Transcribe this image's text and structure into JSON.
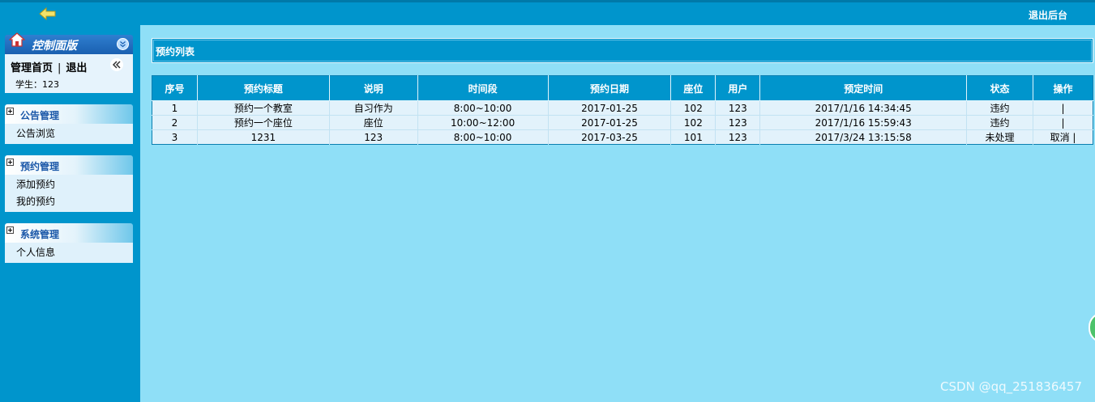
{
  "topbar": {
    "logout_label": "退出后台",
    "back_icon": "back-arrow-icon"
  },
  "sidebar": {
    "panel_title": "控制面版",
    "home_link": "管理首页",
    "separator": "|",
    "exit_link": "退出",
    "student_label": "学生：123",
    "groups": [
      {
        "title": "公告管理",
        "items": [
          "公告浏览"
        ]
      },
      {
        "title": "预约管理",
        "items": [
          "添加预约",
          "我的预约"
        ]
      },
      {
        "title": "系统管理",
        "items": [
          "个人信息"
        ]
      }
    ]
  },
  "main": {
    "list_title": "预约列表",
    "table": {
      "headers": [
        "序号",
        "预约标题",
        "说明",
        "时间段",
        "预约日期",
        "座位",
        "用户",
        "预定时间",
        "状态",
        "操作"
      ],
      "rows": [
        [
          "1",
          "预约一个教室",
          "自习作为",
          "8:00~10:00",
          "2017-01-25",
          "102",
          "123",
          "2017/1/16 14:34:45",
          "违约",
          "|"
        ],
        [
          "2",
          "预约一个座位",
          "座位",
          "10:00~12:00",
          "2017-01-25",
          "102",
          "123",
          "2017/1/16 15:59:43",
          "违约",
          "|"
        ],
        [
          "3",
          "1231",
          "123",
          "8:00~10:00",
          "2017-03-25",
          "101",
          "123",
          "2017/3/24 13:15:58",
          "未处理",
          "取消 |"
        ]
      ]
    }
  },
  "watermark": "CSDN @qq_251836457",
  "colors": {
    "topbar": "#0095cc",
    "content_bg": "#8fdff7",
    "table_header": "#0095cc",
    "menu_title": "#1a57a8"
  }
}
